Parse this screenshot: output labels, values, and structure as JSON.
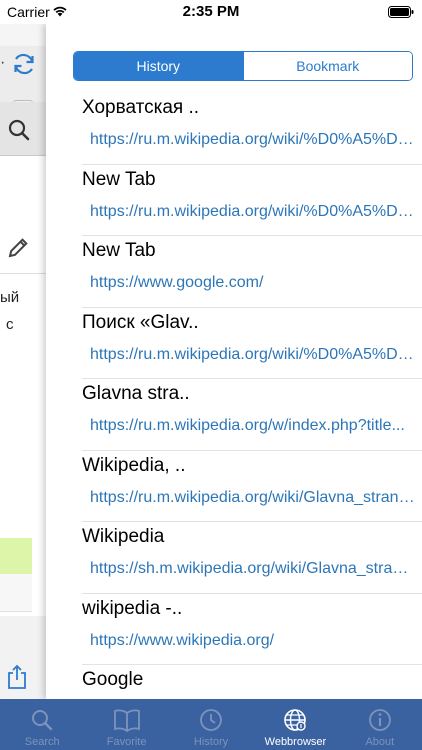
{
  "status_bar": {
    "carrier": "Carrier",
    "time": "2:35 PM"
  },
  "background_app": {
    "text_line1": "ый",
    "text_line2": "с"
  },
  "segmented": {
    "history_label": "History",
    "bookmark_label": "Bookmark",
    "selected": "History"
  },
  "history": [
    {
      "title": "Хорватская ..",
      "url": "https://ru.m.wikipedia.org/wiki/%D0%A5%D0..."
    },
    {
      "title": "New Tab",
      "url": "https://ru.m.wikipedia.org/wiki/%D0%A5%D0..."
    },
    {
      "title": "New Tab",
      "url": "https://www.google.com/"
    },
    {
      "title": "Поиск «Glav..",
      "url": "https://ru.m.wikipedia.org/wiki/%D0%A5%D0..."
    },
    {
      "title": "Glavna stra..",
      "url": "https://ru.m.wikipedia.org/w/index.php?title..."
    },
    {
      "title": "Wikipedia, ..",
      "url": "https://ru.m.wikipedia.org/wiki/Glavna_strana..."
    },
    {
      "title": "Wikipedia",
      "url": "https://sh.m.wikipedia.org/wiki/Glavna_strana..."
    },
    {
      "title": "wikipedia -..",
      "url": "https://www.wikipedia.org/"
    },
    {
      "title": "Google",
      "url": ""
    }
  ],
  "tabbar": {
    "items": [
      {
        "label": "Search",
        "icon": "search-icon"
      },
      {
        "label": "Favorite",
        "icon": "book-icon"
      },
      {
        "label": "History",
        "icon": "clock-icon"
      },
      {
        "label": "Webbrowser",
        "icon": "globe-icon"
      },
      {
        "label": "About",
        "icon": "info-icon"
      }
    ],
    "active": "Webbrowser"
  },
  "colors": {
    "accent": "#2c7bcf",
    "link": "#2c76b8",
    "tabbar_bg": "#3a62a0",
    "tab_inactive": "#7d93bb"
  }
}
